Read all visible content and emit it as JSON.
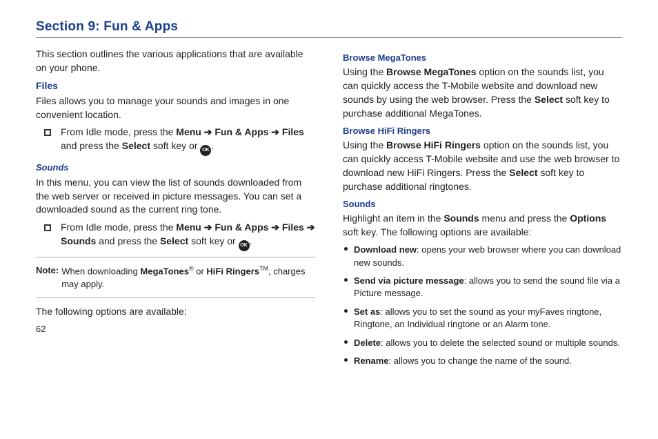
{
  "title": "Section 9: Fun & Apps",
  "pagenum": "62",
  "left": {
    "intro": "This section outlines the various applications that are available on your phone.",
    "files_h": "Files",
    "files_p": "Files allows you to manage your sounds and images in one convenient location.",
    "files_li_1": "From Idle mode, press the ",
    "files_li_2": "Menu",
    "files_li_3": " ➔ ",
    "files_li_4": "Fun & Apps",
    "files_li_5": " ➔ ",
    "files_li_6": "Files",
    "files_li_7": " and press the ",
    "files_li_8": "Select",
    "files_li_9": " soft key or ",
    "files_li_10": ".",
    "sounds_h": "Sounds",
    "sounds_p": "In this menu, you can view the list of sounds downloaded from the web server or received in picture messages. You can set a downloaded sound as the current ring tone.",
    "sounds_li_1": "From Idle mode, press the ",
    "sounds_li_2": "Menu",
    "sounds_li_3": " ➔ ",
    "sounds_li_4": "Fun & Apps",
    "sounds_li_5": " ➔ ",
    "sounds_li_6": "Files",
    "sounds_li_7": " ➔ ",
    "sounds_li_8": "Sounds",
    "sounds_li_9": " and press the ",
    "sounds_li_10": "Select",
    "sounds_li_11": " soft key or ",
    "sounds_li_12": ".",
    "note_lbl": "Note:",
    "note_1": "When downloading ",
    "note_2": "MegaTones",
    "note_3": "®",
    "note_4": " or ",
    "note_5": "HiFi Ringers",
    "note_6": "TM",
    "note_7": ", charges may apply.",
    "opts_p": "The following options are available:",
    "ok": "OK"
  },
  "right": {
    "bmt_h": "Browse MegaTones",
    "bmt_1": "Using the ",
    "bmt_2": "Browse MegaTones",
    "bmt_3": " option on the sounds list, you can quickly access the T-Mobile website and download new sounds by using the web browser. Press the ",
    "bmt_4": "Select",
    "bmt_5": " soft key to purchase additional MegaTones.",
    "bhr_h": "Browse HiFi Ringers",
    "bhr_1": "Using the ",
    "bhr_2": "Browse HiFi Ringers",
    "bhr_3": " option on the sounds list, you can quickly access T-Mobile website and use the web browser to download new HiFi Ringers. Press the ",
    "bhr_4": "Select",
    "bhr_5": " soft key to purchase additional ringtones.",
    "snd_h": "Sounds",
    "snd_1": "Highlight an item in the ",
    "snd_2": "Sounds",
    "snd_3": " menu and press the ",
    "snd_4": "Options",
    "snd_5": " soft key. The following options are available:",
    "b1a": "Download new",
    "b1b": ": opens your web browser where you can download new sounds.",
    "b2a": "Send via picture message",
    "b2b": ": allows you to send the sound file via a Picture message.",
    "b3a": "Set as",
    "b3b": ": allows you to set the sound as your myFaves ringtone, Ringtone, an Individual ringtone or an Alarm tone.",
    "b4a": "Delete",
    "b4b": ": allows you to delete the selected sound or multiple sounds.",
    "b5a": "Rename",
    "b5b": ": allows you to change the name of the sound."
  }
}
